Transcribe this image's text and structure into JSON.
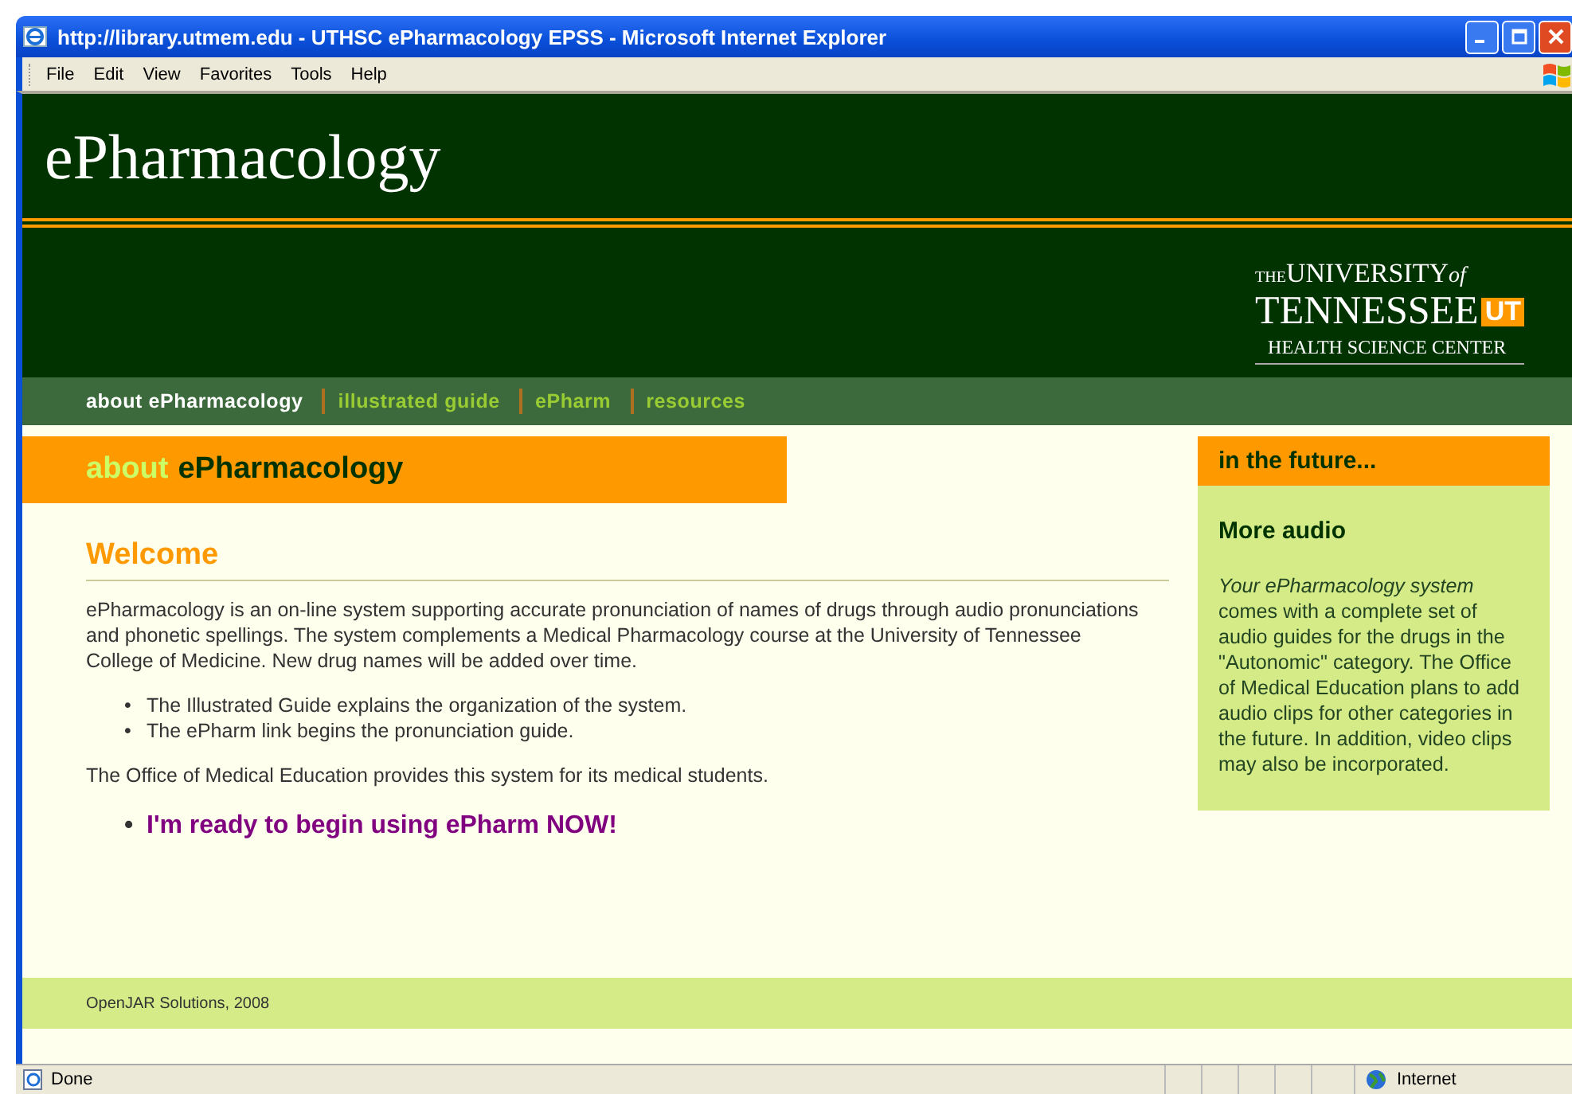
{
  "window": {
    "title": "http://library.utmem.edu - UTHSC ePharmacology EPSS - Microsoft Internet Explorer"
  },
  "menu": [
    "File",
    "Edit",
    "View",
    "Favorites",
    "Tools",
    "Help"
  ],
  "site": {
    "title": "ePharmacology",
    "logo": {
      "the": "THE",
      "university": "UNIVERSITY",
      "of": "of",
      "tennessee": "TENNESSEE",
      "mark": "UT",
      "center": "HEALTH SCIENCE CENTER"
    }
  },
  "nav": [
    {
      "label": "about ePharmacology",
      "selected": true
    },
    {
      "label": "illustrated guide",
      "selected": false
    },
    {
      "label": "ePharm",
      "selected": false
    },
    {
      "label": "resources",
      "selected": false
    }
  ],
  "page_heading": {
    "prefix": "about",
    "title": "ePharmacology"
  },
  "main": {
    "heading": "Welcome",
    "intro": "ePharmacology is an on-line system supporting accurate pronunciation of names of drugs through audio pronunciations and phonetic spellings. The system complements a Medical Pharmacology course at the University of Tennessee College of Medicine. New drug names will be added over time.",
    "marker": "•",
    "bullets": [
      "The Illustrated Guide explains the organization of the system.",
      "The ePharm link begins the pronunciation guide."
    ],
    "note": "The Office of Medical Education provides this system for its medical students.",
    "cta": "I'm ready to begin using ePharm NOW!"
  },
  "sidebar": {
    "heading": "in the future...",
    "title": "More audio",
    "text": "*Your ePharmacology system* comes with a complete set of audio guides for the drugs in the \"Autonomic\" category. The Office of Medical Education plans to add audio clips for other categories in the future. In addition, video clips may also be incorporated."
  },
  "footer": "OpenJAR Solutions, 2008",
  "status_bar": {
    "status": "Done",
    "zone": "Internet"
  }
}
